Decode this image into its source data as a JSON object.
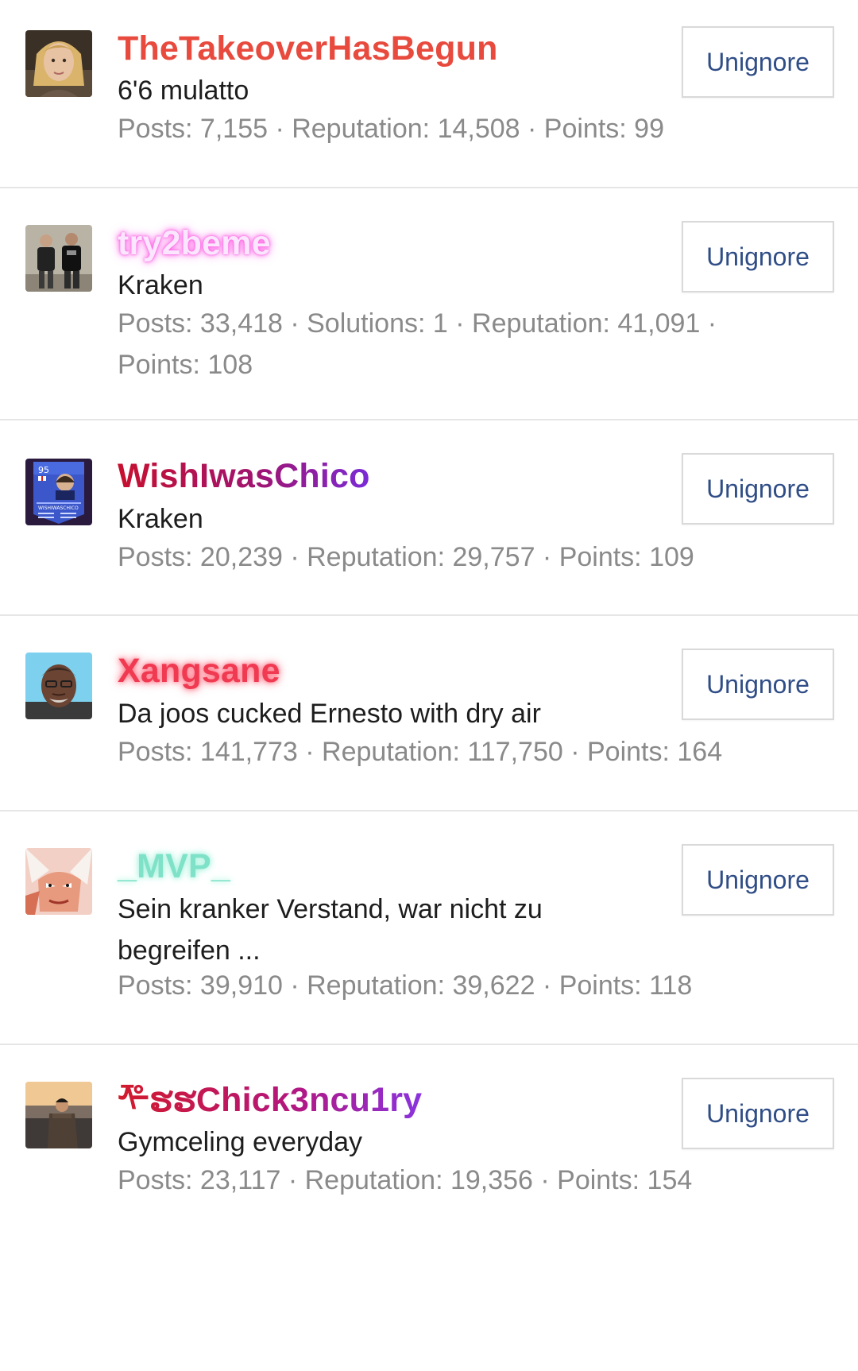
{
  "button_label": "Unignore",
  "colors": {
    "button_text": "#2f4d86",
    "stats_text": "#8a8a8a",
    "title_text": "#1d1d1d",
    "divider": "#e6e6e6"
  },
  "users": [
    {
      "username": "TheTakeoverHasBegun",
      "title": "6'6 mulatto",
      "stats": "Posts: 7,155 · Reputation: 14,508 · Points: 99",
      "avatar_icon": "avatar-blonde-woman"
    },
    {
      "username": "try2beme",
      "title": "Kraken",
      "stats_line1": "Posts: 33,418 · Solutions: 1 · Reputation: 41,091 ·",
      "stats_line2": "Points: 108",
      "avatar_icon": "avatar-two-men"
    },
    {
      "username": "WishIwasChico",
      "title": "Kraken",
      "stats": "Posts: 20,239 · Reputation: 29,757 · Points: 109",
      "avatar_icon": "avatar-fifa-card"
    },
    {
      "username": "Xangsane",
      "title": "Da joos cucked Ernesto with dry air",
      "stats": "Posts: 141,773 · Reputation: 117,750 · Points: 164",
      "avatar_icon": "avatar-older-man"
    },
    {
      "username": "_MVP_",
      "title": "Sein kranker Verstand, war nicht zu begreifen ...",
      "stats": "Posts: 39,910 · Reputation: 39,622 · Points: 118",
      "avatar_icon": "avatar-anime-character"
    },
    {
      "username": "ᢝຮຮChick3ncu1ry",
      "username_display": "ᢝຮຮChick3ncu1ry",
      "title": "Gymceling everyday",
      "stats": "Posts: 23,117 · Reputation: 19,356 · Points: 154",
      "avatar_icon": "avatar-man-at-sunset"
    }
  ]
}
